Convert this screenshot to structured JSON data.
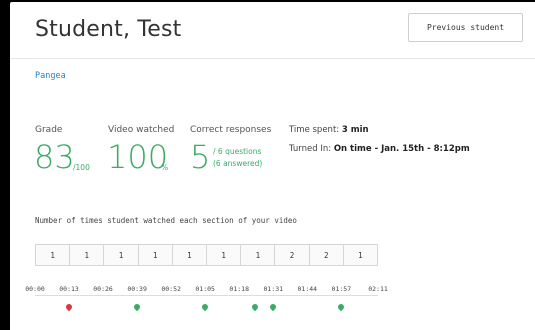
{
  "header": {
    "student_name": "Student, Test",
    "previous_button": "Previous student"
  },
  "course": {
    "name": "Pangea"
  },
  "stats": {
    "grade": {
      "label": "Grade",
      "value": "83",
      "suffix": "/100"
    },
    "video": {
      "label": "Video watched",
      "value": "100",
      "suffix": "%"
    },
    "responses": {
      "label": "Correct responses",
      "value": "5",
      "detail_1": "/ 6 questions",
      "detail_2": "(6 answered)"
    },
    "time_spent": {
      "label": "Time spent:",
      "value": "3 min"
    },
    "turned_in": {
      "label": "Turned In:",
      "value": "On time - Jan. 15th - 8:12pm"
    }
  },
  "sections": {
    "caption": "Number of times student watched each section of your video",
    "counts": [
      "1",
      "1",
      "1",
      "1",
      "1",
      "1",
      "1",
      "2",
      "2",
      "1"
    ],
    "ticks": [
      "00:00",
      "00:13",
      "00:26",
      "00:39",
      "00:52",
      "01:05",
      "01:18",
      "01:31",
      "01:44",
      "01:57",
      "02:11"
    ]
  },
  "markers": [
    {
      "time": "00:13",
      "status": "incorrect"
    },
    {
      "time": "00:39",
      "status": "correct"
    },
    {
      "time": "01:05",
      "status": "correct"
    },
    {
      "time": "01:24",
      "status": "correct"
    },
    {
      "time": "01:31",
      "status": "correct"
    },
    {
      "time": "01:57",
      "status": "correct"
    }
  ],
  "colors": {
    "accent_green": "#3cab66",
    "link_blue": "#2c7fc9",
    "incorrect_red": "#d9363e"
  }
}
